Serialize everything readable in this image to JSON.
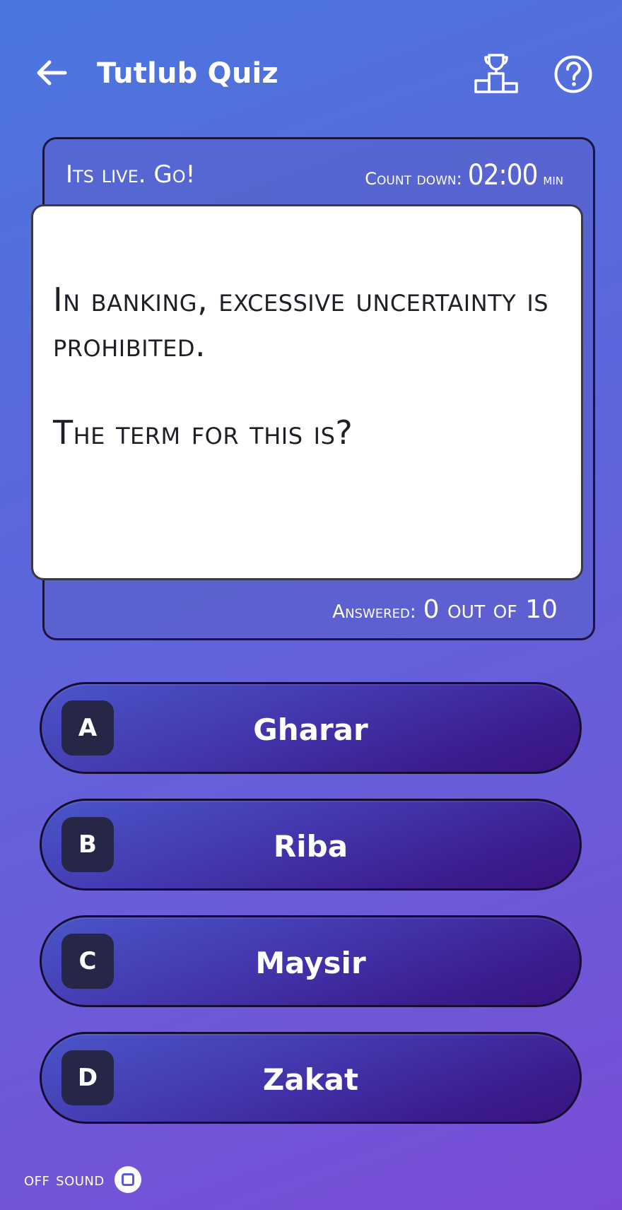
{
  "header": {
    "title": "Tutlub Quiz",
    "back_icon": "arrow-left-icon",
    "leaderboard_icon": "podium-trophy-icon",
    "help_icon": "question-circle-icon"
  },
  "quiz": {
    "status": "Its live. Go!",
    "countdown_label": "Count down:",
    "countdown_value": "02:00",
    "countdown_unit": "min",
    "question_line": "In banking, excessive uncertainty is prohibited.",
    "question_prompt": "The term for this is?",
    "answered_label": "Answered:",
    "answered_value": "0 out of 10"
  },
  "options": [
    {
      "letter": "A",
      "label": "Gharar"
    },
    {
      "letter": "B",
      "label": "Riba"
    },
    {
      "letter": "C",
      "label": "Maysir"
    },
    {
      "letter": "D",
      "label": "Zakat"
    }
  ],
  "footer": {
    "sound_label": "off sound"
  },
  "colors": {
    "background_start": "#4b76dd",
    "background_end": "#7a4cd6",
    "option_fill": "#3b1c8e",
    "letter_badge": "#262646"
  }
}
